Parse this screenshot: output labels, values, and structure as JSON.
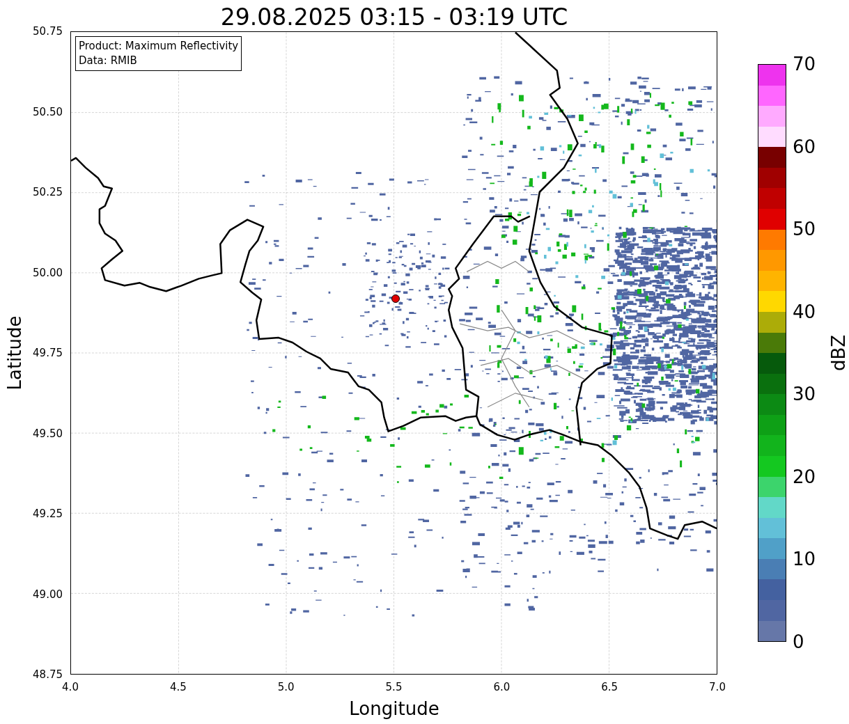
{
  "title": "29.08.2025 03:15 - 03:19 UTC",
  "map": {
    "xlabel": "Longitude",
    "ylabel": "Latitude",
    "xticks": [
      "4.0",
      "4.5",
      "5.0",
      "5.5",
      "6.0",
      "6.5",
      "7.0"
    ],
    "yticks": [
      "50.75",
      "50.50",
      "50.25",
      "50.00",
      "49.75",
      "49.50",
      "49.25",
      "49.00",
      "48.75"
    ],
    "info_box": [
      "Product: Maximum Reflectivity",
      "Data: RMIB"
    ]
  },
  "colorbar": {
    "label": "dBZ",
    "ticks": [
      "70",
      "60",
      "50",
      "40",
      "30",
      "20",
      "10",
      "0"
    ],
    "bands": [
      {
        "color": "#ee33ee"
      },
      {
        "color": "#ff66ff"
      },
      {
        "color": "#ffaaff"
      },
      {
        "color": "#ffdcff"
      },
      {
        "color": "#780000"
      },
      {
        "color": "#a00000"
      },
      {
        "color": "#c00000"
      },
      {
        "color": "#e00000"
      },
      {
        "color": "#ff7a00"
      },
      {
        "color": "#ff9800"
      },
      {
        "color": "#ffb400"
      },
      {
        "color": "#ffd800"
      },
      {
        "color": "#acac08"
      },
      {
        "color": "#4a7a08"
      },
      {
        "color": "#065a0c"
      },
      {
        "color": "#0a700e"
      },
      {
        "color": "#0c8a14"
      },
      {
        "color": "#0ea016"
      },
      {
        "color": "#12b41c"
      },
      {
        "color": "#14c820"
      },
      {
        "color": "#3cd46c"
      },
      {
        "color": "#62d8c8"
      },
      {
        "color": "#62c0d8"
      },
      {
        "color": "#50a0c8"
      },
      {
        "color": "#4a7eb4"
      },
      {
        "color": "#4461a0"
      },
      {
        "color": "#5066a2"
      },
      {
        "color": "#6677a8"
      }
    ]
  }
}
